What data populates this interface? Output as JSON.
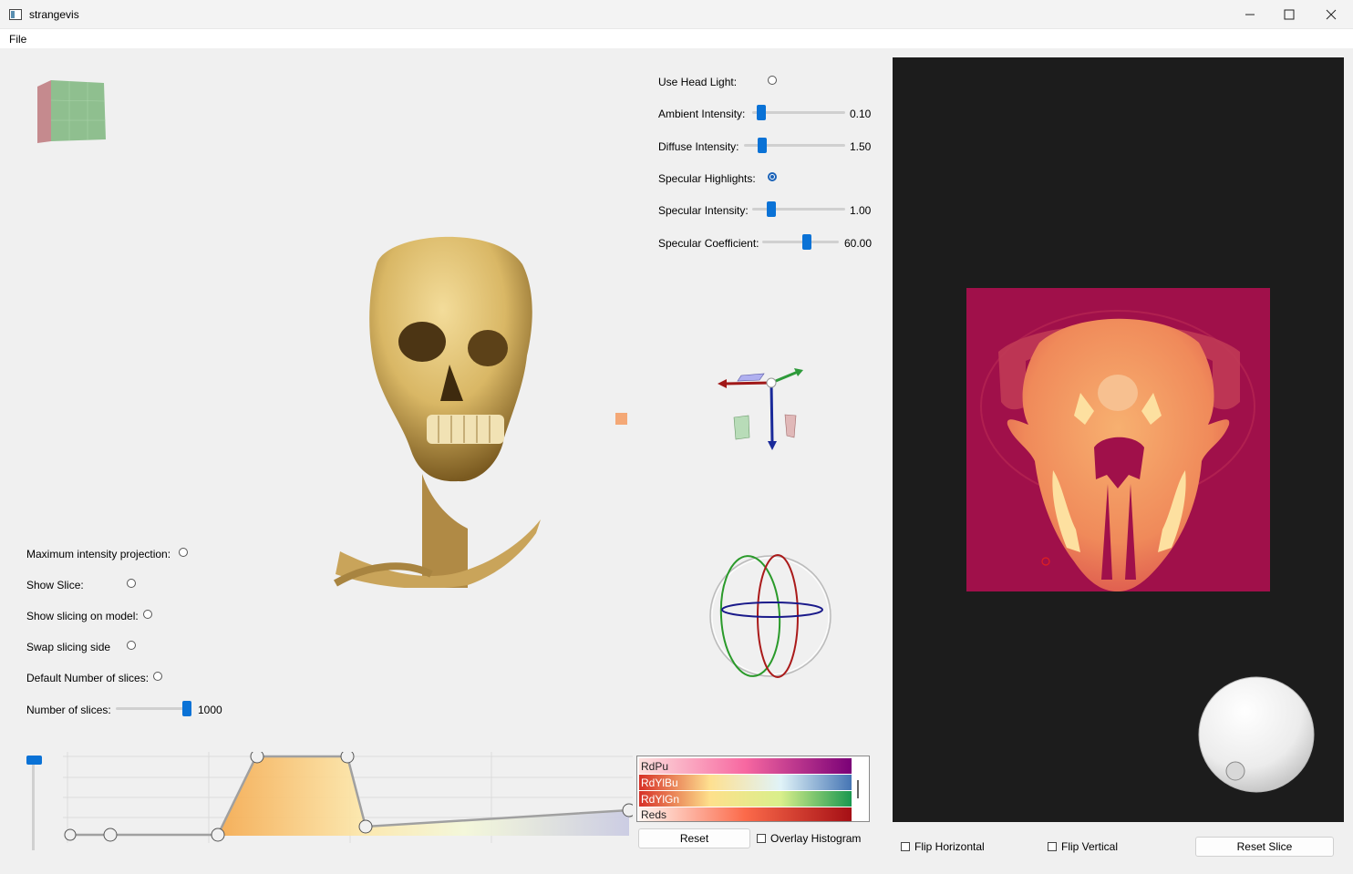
{
  "window": {
    "title": "strangevis"
  },
  "menu": {
    "file": "File"
  },
  "lighting": {
    "head_light_label": "Use Head Light:",
    "ambient_label": "Ambient Intensity:",
    "ambient_value": "0.10",
    "ambient_level": 0.05,
    "diffuse_label": "Diffuse Intensity:",
    "diffuse_value": "1.50",
    "diffuse_level": 0.15,
    "specular_highlights_label": "Specular Highlights:",
    "specular_intensity_label": "Specular Intensity:",
    "specular_intensity_value": "1.00",
    "specular_intensity_level": 0.1,
    "specular_coeff_label": "Specular Coefficient:",
    "specular_coeff_value": "60.00",
    "specular_coeff_level": 0.6
  },
  "render_options": {
    "mip_label": "Maximum intensity projection:",
    "show_slice_label": "Show Slice:",
    "show_slicing_model_label": "Show slicing on model:",
    "swap_slicing_label": "Swap slicing side",
    "default_slices_label": "Default Number of slices:",
    "num_slices_label": "Number of slices:",
    "num_slices_value": "1000",
    "num_slices_level": 1.0
  },
  "transfer_function": {
    "colormaps": [
      "RdPu",
      "RdYlBu",
      "RdYlGn",
      "Reds"
    ],
    "reset_label": "Reset",
    "overlay_histogram_label": "Overlay Histogram"
  },
  "slice_panel": {
    "flip_horizontal_label": "Flip Horizontal",
    "flip_vertical_label": "Flip Vertical",
    "reset_slice_label": "Reset Slice"
  },
  "colors": {
    "accent": "#0a72d6",
    "slice_background": "#1c1c1c",
    "slice_base": "#a0104a"
  }
}
